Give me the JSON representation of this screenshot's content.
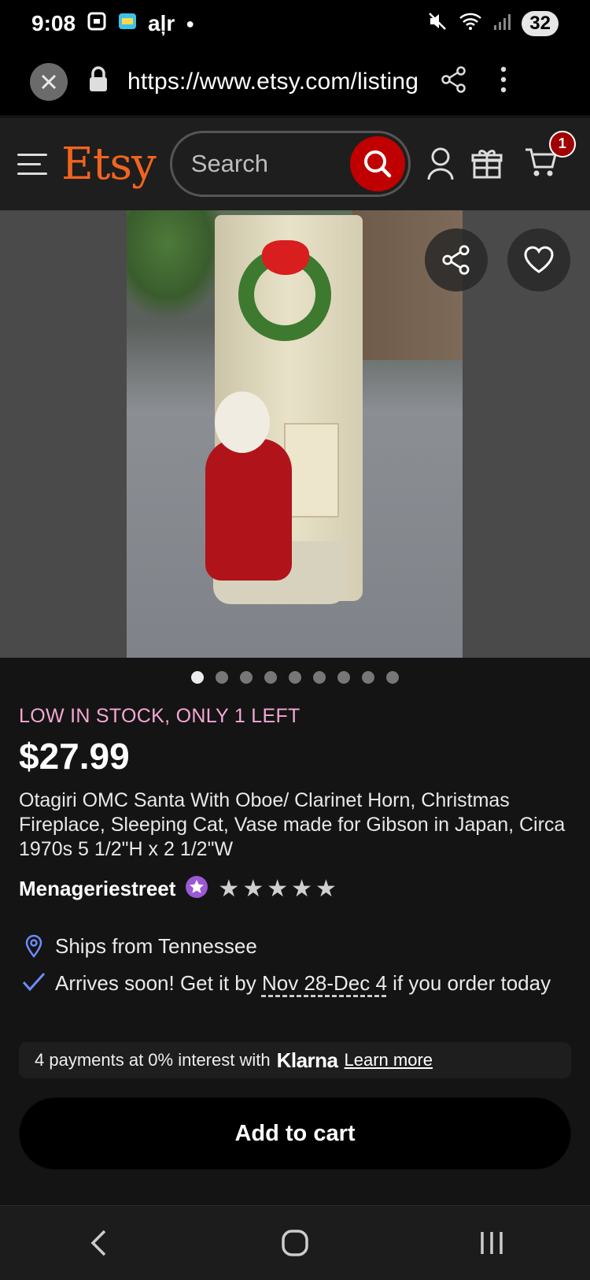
{
  "status_bar": {
    "time": "9:08",
    "notification_text": "aļr",
    "battery": "32"
  },
  "browser": {
    "url": "https://www.etsy.com/listing"
  },
  "header": {
    "logo": "Etsy",
    "search_placeholder": "Search",
    "cart_count": "1"
  },
  "gallery": {
    "image_count": 9,
    "active_index": 0
  },
  "listing": {
    "stock_notice": "LOW IN STOCK, ONLY 1 LEFT",
    "price": "$27.99",
    "title": "Otagiri OMC Santa With Oboe/ Clarinet Horn, Christmas Fireplace, Sleeping Cat, Vase made for Gibson in Japan, Circa 1970s 5 1/2\"H x 2 1/2\"W",
    "shop_name": "Menageriestreet",
    "rating_stars": 5
  },
  "shipping": {
    "ships_from": "Ships from Tennessee",
    "arrives_prefix": "Arrives soon! Get it by ",
    "arrives_date": "Nov 28-Dec 4",
    "arrives_suffix": " if you order today"
  },
  "klarna": {
    "text": "4 payments at 0% interest with",
    "logo": "Klarna",
    "link": "Learn more"
  },
  "actions": {
    "add_to_cart": "Add to cart"
  },
  "colors": {
    "brand": "#f1641e",
    "search_button": "#c00000",
    "stock_notice": "#f4a8d4",
    "check": "#6b8cff"
  }
}
